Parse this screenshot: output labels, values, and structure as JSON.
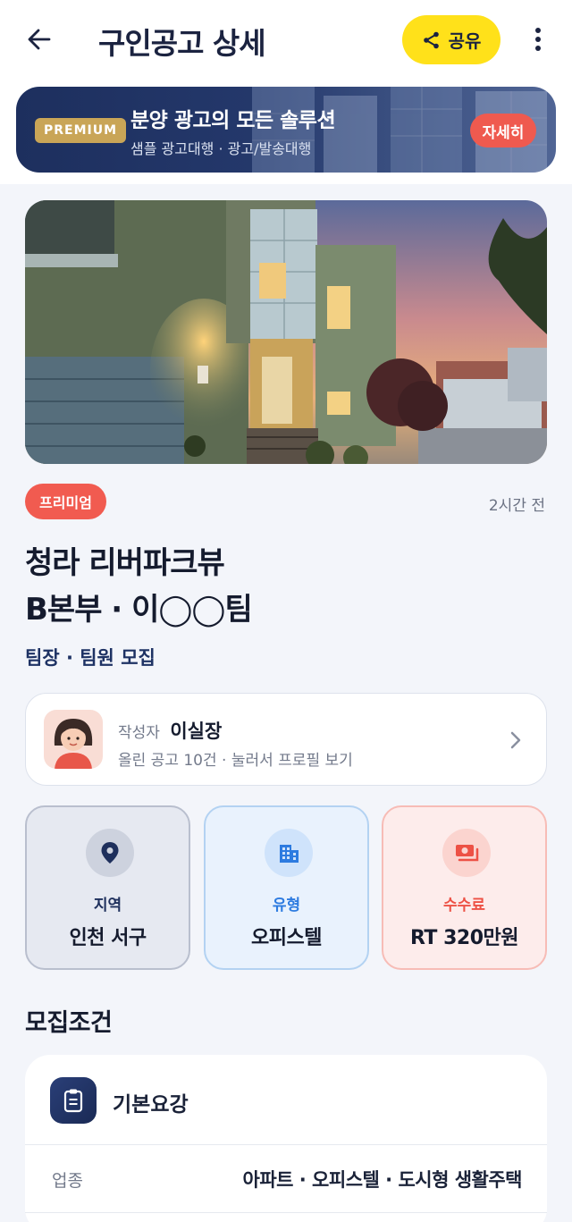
{
  "header": {
    "title": "구인공고 상세",
    "share_label": "공유"
  },
  "banner": {
    "tag": "PREMIUM",
    "title": "분양 광고의 모든 솔루션",
    "subtitle": "샘플 광고대행 · 광고/발송대행",
    "button": "자세히"
  },
  "post": {
    "badge": "프리미엄",
    "time": "2시간 전",
    "title_line1": "청라 리버파크뷰",
    "title_line2": "B본부 · 이◯◯팀",
    "subtitle": "팀장 · 팀원 모집"
  },
  "author": {
    "label": "작성자",
    "name": "이실장",
    "meta": "올린 공고 10건 · 눌러서 프로필 보기"
  },
  "info_cards": [
    {
      "label": "지역",
      "value": "인천 서구",
      "icon": "location-pin-icon"
    },
    {
      "label": "유형",
      "value": "오피스텔",
      "icon": "building-icon"
    },
    {
      "label": "수수료",
      "value": "RT 320만원",
      "icon": "money-icon"
    }
  ],
  "conditions": {
    "section_title": "모집조건",
    "card_title": "기본요강",
    "rows": [
      {
        "label": "업종",
        "value": "아파트 · 오피스텔 · 도시형 생활주택"
      }
    ]
  }
}
